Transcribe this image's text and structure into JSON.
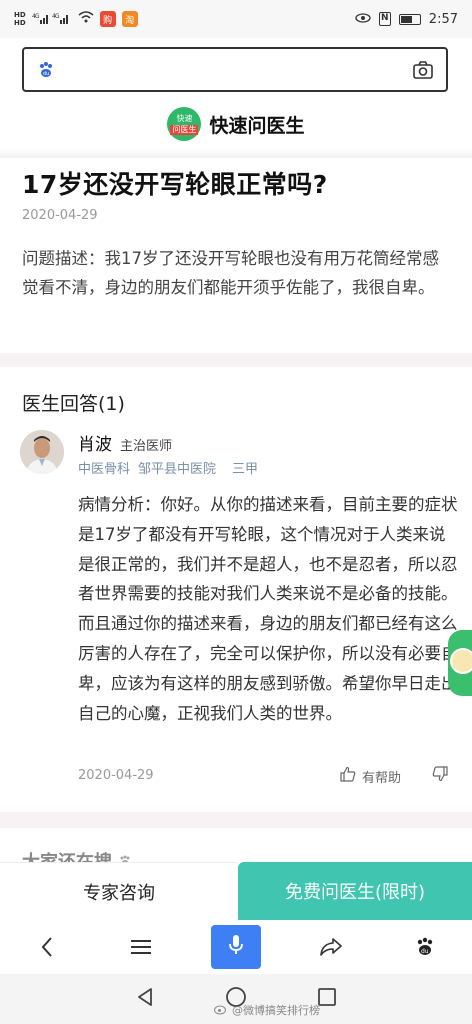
{
  "status_bar": {
    "sim1": "HD",
    "sim2": "HD",
    "network": "4G",
    "time": "2:57",
    "app_badge_1": "购",
    "app_badge_2": "淘"
  },
  "search": {
    "placeholder": ""
  },
  "brand": {
    "logo_line1": "快速",
    "logo_line2": "问医生",
    "name": "快速问医生"
  },
  "question": {
    "title": "17岁还没开写轮眼正常吗?",
    "date": "2020-04-29",
    "description": "问题描述：我17岁了还没开写轮眼也没有用万花筒经常感觉看不清，身边的朋友们都能开须乎佐能了，我很自卑。"
  },
  "answers": {
    "heading": "医生回答(1)",
    "doctor": {
      "name": "肖波",
      "title": "主治医师",
      "department": "中医骨科",
      "hospital": "邹平县中医院",
      "tier": "三甲"
    },
    "body": "病情分析：你好。从你的描述来看，目前主要的症状是17岁了都没有开写轮眼，这个情况对于人类来说是很正常的，我们并不是超人，也不是忍者，所以忍者世界需要的技能对我们人类来说不是必备的技能。而且通过你的描述来看，身边的朋友们都已经有这么厉害的人存在了，完全可以保护你，所以没有必要自卑，应该为有这样的朋友感到骄傲。希望你早日走出自己的心魔，正视我们人类的世界。",
    "date": "2020-04-29",
    "helpful_label": "有帮助"
  },
  "also_search": "大家还在搜",
  "cta": {
    "left_label": "专家咨询",
    "right_label": "免费问医生(限时)"
  },
  "watermark": "@微博搞笑排行榜",
  "colors": {
    "cta_accent": "#3fc5b0",
    "brand_green": "#2fb86a",
    "mic_blue": "#3f7ff5",
    "org_text": "#7a8fa8"
  }
}
